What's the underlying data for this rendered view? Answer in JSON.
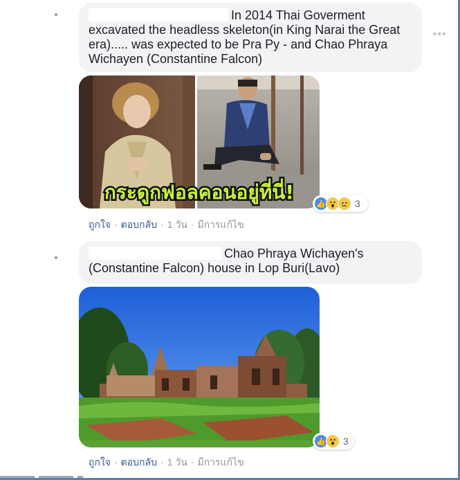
{
  "comments": [
    {
      "text": "In 2014 Thai Goverment excavated the headless skeleton(in King Narai the Great era)..... was expected to be Pra Py - and Chao Phraya Wichayen (Constantine Falcon)",
      "image_caption": "กระดูกฟอลคอนอยู่ที่นี่!",
      "reaction_count": "3",
      "actions": {
        "like": "ถูกใจ",
        "reply": "ตอบกลับ",
        "time": "1 วัน",
        "edited": "มีการแก้ไข"
      }
    },
    {
      "text": "Chao Phraya Wichayen's (Constantine Falcon) house in Lop Buri(Lavo)",
      "reaction_count": "3",
      "actions": {
        "like": "ถูกใจ",
        "reply": "ตอบกลับ",
        "time": "1 วัน",
        "edited": "มีการแก้ไข"
      }
    }
  ],
  "icons": {
    "more": "more-options-icon",
    "like": "like-reaction-icon",
    "wow": "wow-reaction-icon",
    "sad": "sad-reaction-icon"
  },
  "colors": {
    "bubble": "#f2f3f5",
    "link": "#385898",
    "meta": "#90949c",
    "like_blue": "#4a8bf2",
    "emoji_yellow": "#f7c94a",
    "caption_green": "#c9f23a"
  },
  "separator": "·"
}
